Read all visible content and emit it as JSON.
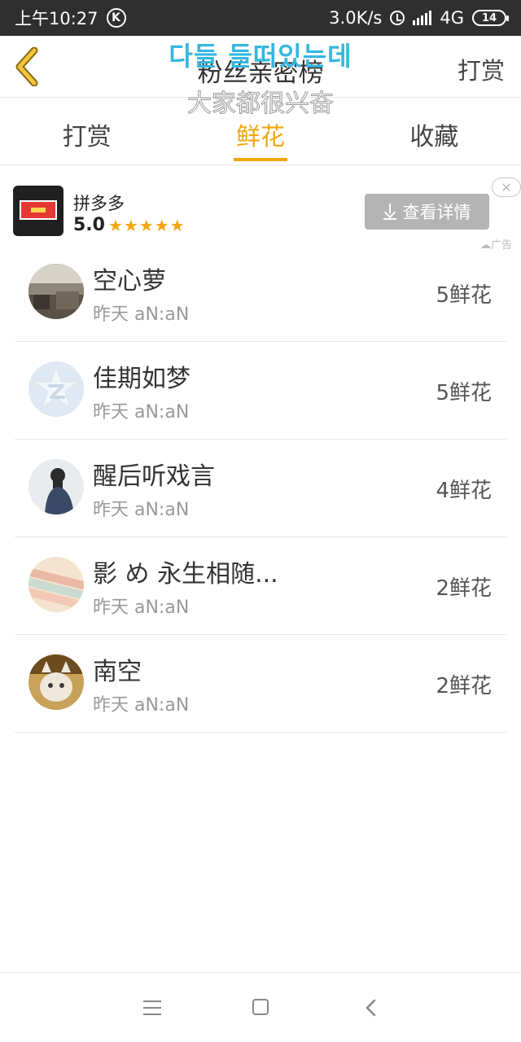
{
  "status_bar": {
    "time": "上午10:27",
    "k_badge": "K",
    "speed": "3.0K/s",
    "network": "4G",
    "battery": "14",
    "icons": [
      "k-icon",
      "alarm-icon",
      "signal-icon",
      "battery-icon"
    ]
  },
  "header": {
    "title": "粉丝亲密榜",
    "reward_label": "打赏",
    "back_icon": "chevron-left-icon"
  },
  "overlay": {
    "korean": "다들 들떠있는데",
    "chinese": "大家都很兴奋"
  },
  "tabs": [
    {
      "label": "打赏",
      "active": false
    },
    {
      "label": "鲜花",
      "active": true
    },
    {
      "label": "收藏",
      "active": false
    }
  ],
  "ad": {
    "app_name": "拼多多",
    "rating": "5.0",
    "stars": "★★★★★",
    "detail_button": "查看详情",
    "close": "✕",
    "tag": "☁广告"
  },
  "list": [
    {
      "name": "空心萝",
      "time": "昨天 aN:aN",
      "count": "5鲜花"
    },
    {
      "name": "佳期如梦",
      "time": "昨天 aN:aN",
      "count": "5鲜花"
    },
    {
      "name": "醒后听戏言",
      "time": "昨天 aN:aN",
      "count": "4鲜花"
    },
    {
      "name": "影 め 永生相随...",
      "time": "昨天 aN:aN",
      "count": "2鲜花"
    },
    {
      "name": "南空",
      "time": "昨天 aN:aN",
      "count": "2鲜花"
    }
  ],
  "colors": {
    "accent": "#f2a60f",
    "status_bar": "#2f2f2f",
    "overlay_ko": "#35b7e0"
  }
}
